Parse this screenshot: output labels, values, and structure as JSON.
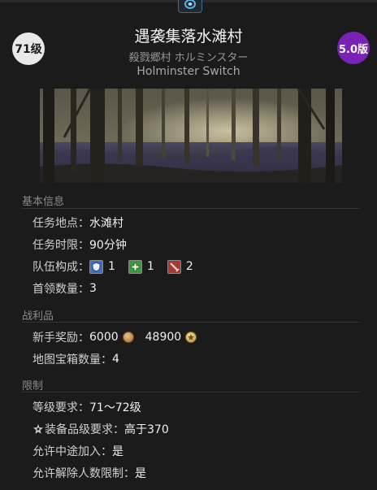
{
  "header": {
    "level": "71级",
    "version": "5.0版",
    "title": "遇袭集落水滩村",
    "subtitle_jp": "殺戮郷村 ホルミンスター",
    "subtitle_en": "Holminster Switch",
    "emblem_icon": "duty-emblem-icon"
  },
  "basic_info": {
    "section_title": "基本信息",
    "location_label": "任务地点：",
    "location_value": "水滩村",
    "time_label": "任务时限：",
    "time_value": "90分钟",
    "party_label": "队伍构成：",
    "party": [
      {
        "role": "tank",
        "icon": "tank-shield-icon",
        "count": "1",
        "color": "#3d6fc6"
      },
      {
        "role": "healer",
        "icon": "healer-cross-icon",
        "count": "1",
        "color": "#3f9a3a"
      },
      {
        "role": "dps",
        "icon": "dps-sword-icon",
        "count": "2",
        "color": "#a43a34"
      }
    ],
    "boss_label": "首领数量：",
    "boss_value": "3"
  },
  "loot": {
    "section_title": "战利品",
    "reward_label": "新手奖励：",
    "gil_value": "6000",
    "gil_icon": "gil-coin-icon",
    "tomestone_value": "48900",
    "tomestone_icon": "tomestone-icon",
    "chest_label": "地图宝箱数量：",
    "chest_value": "4"
  },
  "limits": {
    "section_title": "限制",
    "level_req_label": "等级要求：",
    "level_req_value": "71～72级",
    "ilvl_icon": "item-level-icon",
    "ilvl_label": "装备品级要求：",
    "ilvl_value": "高于370",
    "join_label": "允许中途加入：",
    "join_value": "是",
    "unrestricted_label": "允许解除人数限制：",
    "unrestricted_value": "是"
  },
  "colors": {
    "background": "#1b1b1b",
    "version_badge": "#7b22b6",
    "level_badge": "#e9e9e9",
    "section_title": "#8a8a8a"
  }
}
